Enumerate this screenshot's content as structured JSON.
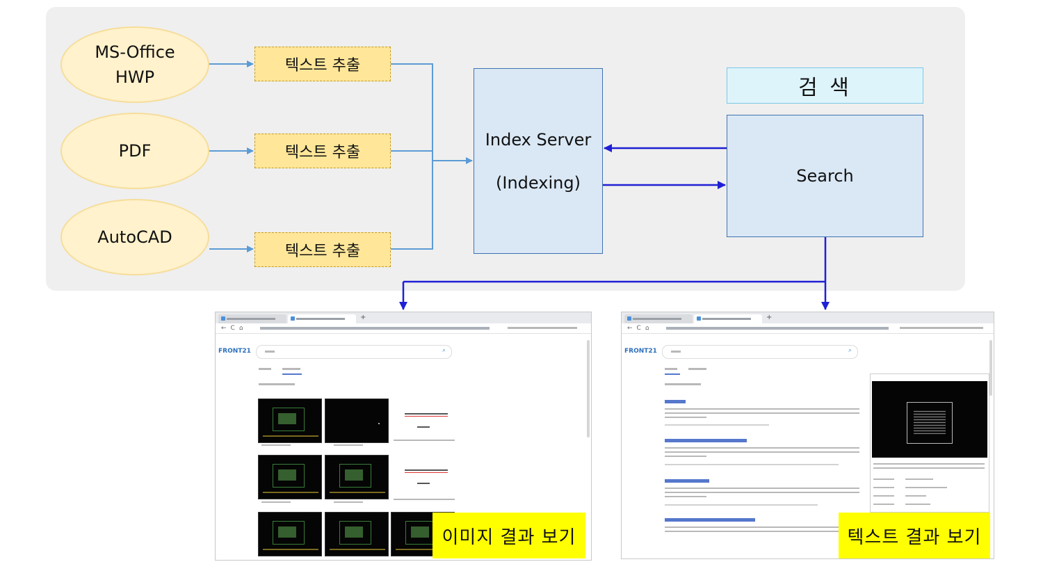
{
  "sources": [
    {
      "label": "MS-Office\nHWP"
    },
    {
      "label": "PDF"
    },
    {
      "label": "AutoCAD"
    }
  ],
  "extract_label": "텍스트 추출",
  "index_server": {
    "line1": "Index Server",
    "line2": "(Indexing)"
  },
  "search_header": "검 색",
  "search_box": "Search",
  "captions": {
    "image": "이미지 결과 보기",
    "text": "텍스트 결과 보기"
  },
  "colors": {
    "panel": "#efefef",
    "source_fill": "#fff2cc",
    "extract_fill": "#ffe699",
    "server_fill": "#dae8f5",
    "search_header_fill": "#def4fb",
    "thin_arrow": "#5b9bd5",
    "bold_arrow": "#1f1fd6",
    "caption_fill": "#ffff00"
  },
  "icons": [
    "arrow-right-icon",
    "arrow-left-icon",
    "arrow-down-icon",
    "search-icon",
    "browser-back-icon",
    "browser-forward-icon",
    "browser-refresh-icon"
  ]
}
